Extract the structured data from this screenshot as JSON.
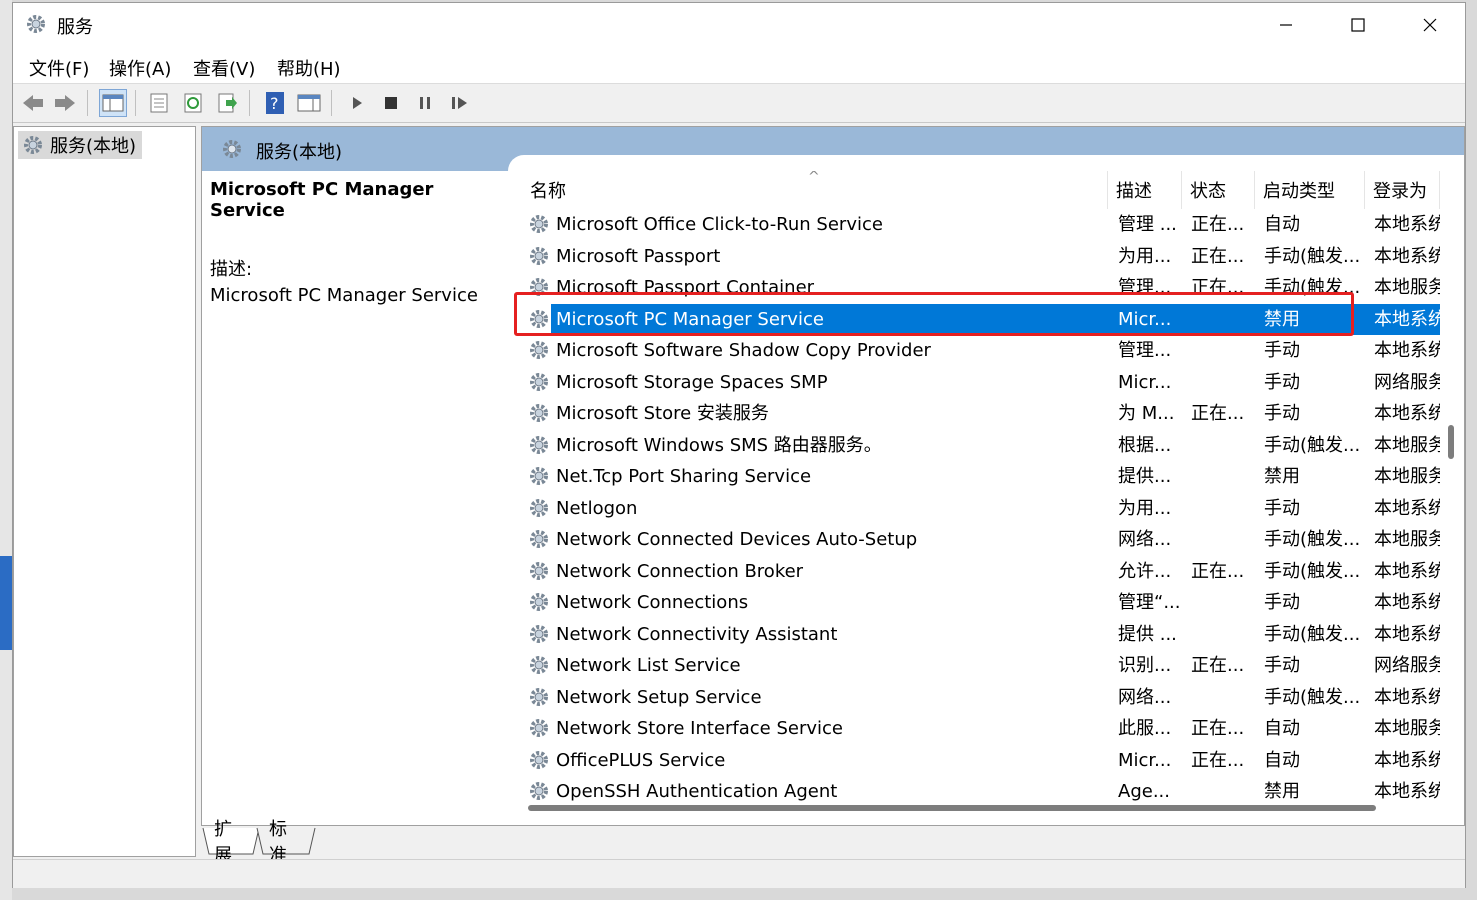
{
  "window": {
    "title": "服务"
  },
  "menu": [
    "文件(F)",
    "操作(A)",
    "查看(V)",
    "帮助(H)"
  ],
  "tree": {
    "root_label": "服务(本地)"
  },
  "main": {
    "header_title": "服务(本地)",
    "selected_title": "Microsoft PC Manager Service",
    "desc_label": "描述:",
    "desc_text": "Microsoft PC Manager Service"
  },
  "columns": [
    "名称",
    "描述",
    "状态",
    "启动类型",
    "登录为"
  ],
  "rows": [
    {
      "name": "Microsoft Office Click-to-Run Service",
      "desc": "管理 ...",
      "status": "正在...",
      "startup": "自动",
      "logon": "本地系统"
    },
    {
      "name": "Microsoft Passport",
      "desc": "为用...",
      "status": "正在...",
      "startup": "手动(触发...",
      "logon": "本地系统"
    },
    {
      "name": "Microsoft Passport Container",
      "desc": "管理...",
      "status": "正在...",
      "startup": "手动(触发...",
      "logon": "本地服务"
    },
    {
      "name": "Microsoft PC Manager Service",
      "desc": "Micr...",
      "status": "",
      "startup": "禁用",
      "logon": "本地系统"
    },
    {
      "name": "Microsoft Software Shadow Copy Provider",
      "desc": "管理...",
      "status": "",
      "startup": "手动",
      "logon": "本地系统"
    },
    {
      "name": "Microsoft Storage Spaces SMP",
      "desc": "Micr...",
      "status": "",
      "startup": "手动",
      "logon": "网络服务"
    },
    {
      "name": "Microsoft Store 安装服务",
      "desc": "为 M...",
      "status": "正在...",
      "startup": "手动",
      "logon": "本地系统"
    },
    {
      "name": "Microsoft Windows SMS 路由器服务。",
      "desc": "根据...",
      "status": "",
      "startup": "手动(触发...",
      "logon": "本地服务"
    },
    {
      "name": "Net.Tcp Port Sharing Service",
      "desc": "提供...",
      "status": "",
      "startup": "禁用",
      "logon": "本地服务"
    },
    {
      "name": "Netlogon",
      "desc": "为用...",
      "status": "",
      "startup": "手动",
      "logon": "本地系统"
    },
    {
      "name": "Network Connected Devices Auto-Setup",
      "desc": "网络...",
      "status": "",
      "startup": "手动(触发...",
      "logon": "本地服务"
    },
    {
      "name": "Network Connection Broker",
      "desc": "允许...",
      "status": "正在...",
      "startup": "手动(触发...",
      "logon": "本地系统"
    },
    {
      "name": "Network Connections",
      "desc": "管理“...",
      "status": "",
      "startup": "手动",
      "logon": "本地系统"
    },
    {
      "name": "Network Connectivity Assistant",
      "desc": "提供 ...",
      "status": "",
      "startup": "手动(触发...",
      "logon": "本地系统"
    },
    {
      "name": "Network List Service",
      "desc": "识别...",
      "status": "正在...",
      "startup": "手动",
      "logon": "网络服务"
    },
    {
      "name": "Network Setup Service",
      "desc": "网络...",
      "status": "",
      "startup": "手动(触发...",
      "logon": "本地系统"
    },
    {
      "name": "Network Store Interface Service",
      "desc": "此服...",
      "status": "正在...",
      "startup": "自动",
      "logon": "本地服务"
    },
    {
      "name": "OfficePLUS Service",
      "desc": "Micr...",
      "status": "正在...",
      "startup": "自动",
      "logon": "本地系统"
    },
    {
      "name": "OpenSSH Authentication Agent",
      "desc": "Age...",
      "status": "",
      "startup": "禁用",
      "logon": "本地系统"
    }
  ],
  "tabs": [
    "扩展",
    "标准"
  ],
  "colors": {
    "selection": "#0078d7",
    "highlight_box": "#e52020",
    "header_band": "#9ab8d8"
  }
}
